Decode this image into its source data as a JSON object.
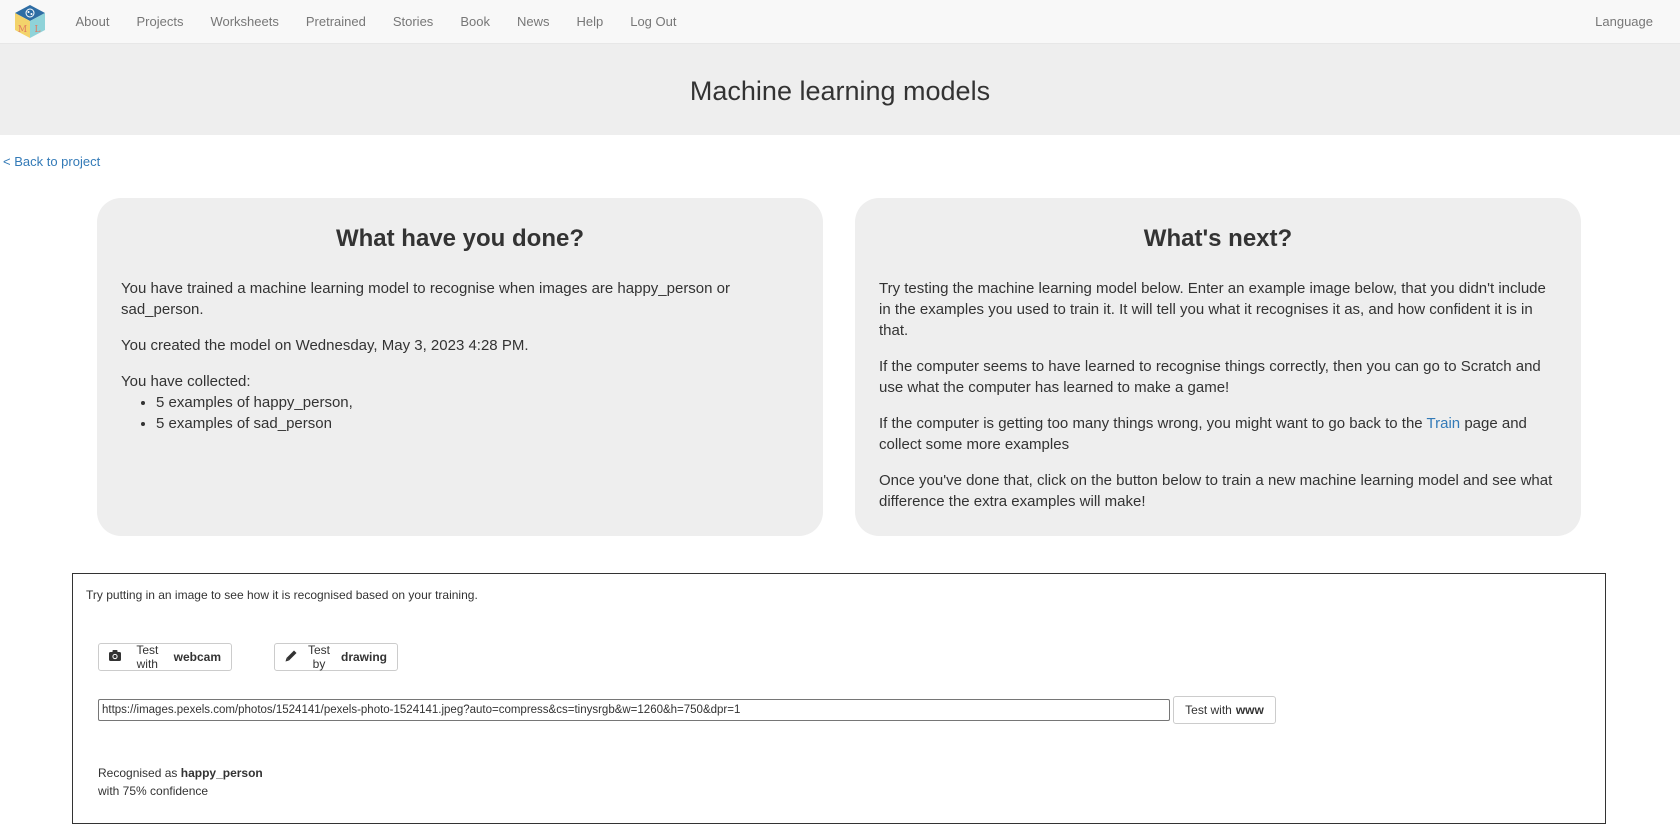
{
  "navbar": {
    "logo_label": "Machine Learning for Kids logo",
    "items": [
      {
        "label": "About"
      },
      {
        "label": "Projects"
      },
      {
        "label": "Worksheets"
      },
      {
        "label": "Pretrained"
      },
      {
        "label": "Stories"
      },
      {
        "label": "Book"
      },
      {
        "label": "News"
      },
      {
        "label": "Help"
      },
      {
        "label": "Log Out"
      }
    ],
    "language": "Language"
  },
  "header": {
    "title": "Machine learning models"
  },
  "back_link": "< Back to project",
  "done_card": {
    "title": "What have you done?",
    "trained_text": "You have trained a machine learning model to recognise when images are happy_person or sad_person.",
    "created_text": "You created the model on Wednesday, May 3, 2023 4:28 PM.",
    "collected_label": "You have collected:",
    "collected_items": [
      "5 examples of happy_person,",
      "5 examples of sad_person"
    ]
  },
  "next_card": {
    "title": "What's next?",
    "p1": "Try testing the machine learning model below. Enter an example image below, that you didn't include in the examples you used to train it. It will tell you what it recognises it as, and how confident it is in that.",
    "p2": "If the computer seems to have learned to recognise things correctly, then you can go to Scratch and use what the computer has learned to make a game!",
    "p3_before": "If the computer is getting too many things wrong, you might want to go back to the ",
    "p3_link": "Train",
    "p3_after": " page and collect some more examples",
    "p4": "Once you've done that, click on the button below to train a new machine learning model and see what difference the extra examples will make!"
  },
  "test_panel": {
    "intro": "Try putting in an image to see how it is recognised based on your training.",
    "webcam_button": {
      "prefix": "Test with",
      "bold": "webcam",
      "icon": "camera-icon"
    },
    "draw_button": {
      "prefix": "Test by",
      "bold": "drawing",
      "icon": "pencil-icon"
    },
    "url_input_value": "https://images.pexels.com/photos/1524141/pexels-photo-1524141.jpeg?auto=compress&cs=tinysrgb&w=1260&h=750&dpr=1",
    "www_button": {
      "prefix": "Test with",
      "bold": "www"
    },
    "result": {
      "prefix": "Recognised as",
      "label": "happy_person",
      "confidence_text": "with 75% confidence",
      "confidence_percent": 75
    }
  },
  "colors": {
    "link": "#337ab7",
    "navbar_bg": "#f8f8f8",
    "jumbotron_bg": "#eeeeee",
    "card_bg": "#eeeeee"
  }
}
